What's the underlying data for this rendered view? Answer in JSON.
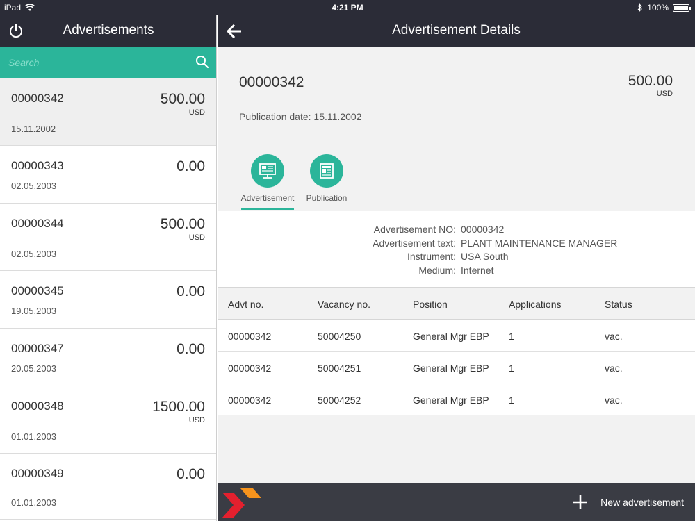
{
  "status_bar": {
    "device": "iPad",
    "time": "4:21 PM",
    "battery": "100%",
    "battery_level": 1.0
  },
  "left": {
    "title": "Advertisements",
    "search": {
      "placeholder": "Search",
      "value": ""
    },
    "items": [
      {
        "id": "00000342",
        "amount": "500.00",
        "currency": "USD",
        "date": "15.11.2002"
      },
      {
        "id": "00000343",
        "amount": "0.00",
        "currency": "",
        "date": "02.05.2003"
      },
      {
        "id": "00000344",
        "amount": "500.00",
        "currency": "USD",
        "date": "02.05.2003"
      },
      {
        "id": "00000345",
        "amount": "0.00",
        "currency": "",
        "date": "19.05.2003"
      },
      {
        "id": "00000347",
        "amount": "0.00",
        "currency": "",
        "date": "20.05.2003"
      },
      {
        "id": "00000348",
        "amount": "1500.00",
        "currency": "USD",
        "date": "01.01.2003"
      },
      {
        "id": "00000349",
        "amount": "0.00",
        "currency": "",
        "date": "01.01.2003"
      }
    ]
  },
  "right": {
    "title": "Advertisement Details",
    "detail": {
      "id": "00000342",
      "amount": "500.00",
      "currency": "USD",
      "publication": "Publication date: 15.11.2002"
    },
    "tabs": [
      {
        "label": "Advertisement",
        "icon": "advertisement-monitor-icon"
      },
      {
        "label": "Publication",
        "icon": "publication-newspaper-icon"
      }
    ],
    "info": [
      {
        "label": "Advertisement NO:",
        "value": "00000342"
      },
      {
        "label": "Advertisement text:",
        "value": "PLANT MAINTENANCE MANAGER"
      },
      {
        "label": "Instrument:",
        "value": "USA South"
      },
      {
        "label": "Medium:",
        "value": "Internet"
      }
    ],
    "table": {
      "headers": [
        "Advt no.",
        "Vacancy no.",
        "Position",
        "Applications",
        "Status"
      ],
      "rows": [
        [
          "00000342",
          "50004250",
          "General Mgr EBP",
          "1",
          "vac."
        ],
        [
          "00000342",
          "50004251",
          "General Mgr EBP",
          "1",
          "vac."
        ],
        [
          "00000342",
          "50004252",
          "General Mgr EBP",
          "1",
          "vac."
        ]
      ]
    }
  },
  "footer": {
    "new_label": "New advertisement"
  },
  "colors": {
    "header": "#2b2c37",
    "accent": "#2bb59a",
    "footer": "#3a3c44",
    "logo_red": "#e4202e",
    "logo_orange": "#f7941d"
  }
}
